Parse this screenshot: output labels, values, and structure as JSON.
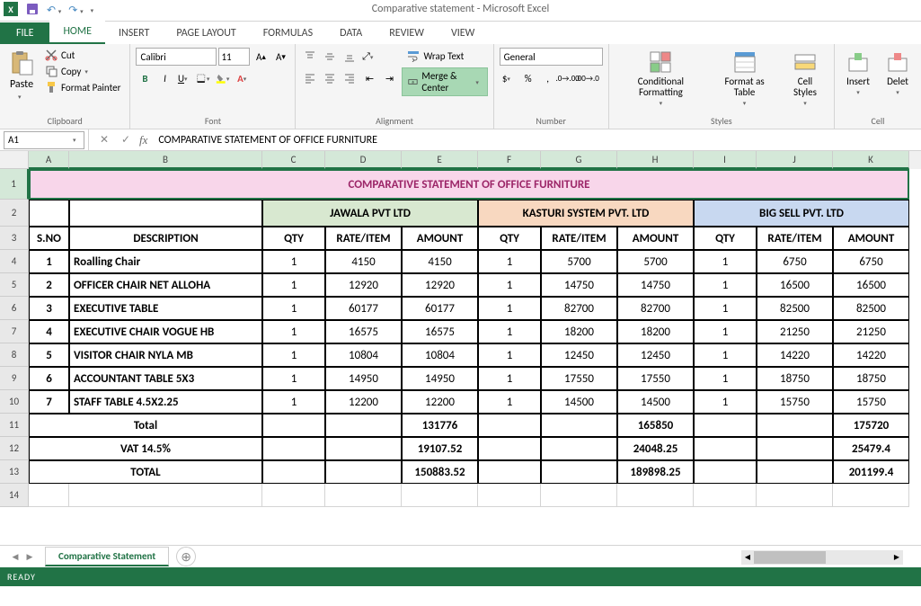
{
  "app": {
    "title": "Comparative statement - Microsoft Excel"
  },
  "tabs": {
    "file": "FILE",
    "home": "HOME",
    "insert": "INSERT",
    "page": "PAGE LAYOUT",
    "formulas": "FORMULAS",
    "data": "DATA",
    "review": "REVIEW",
    "view": "VIEW"
  },
  "clipboard": {
    "paste": "Paste",
    "cut": "Cut",
    "copy": "Copy",
    "painter": "Format Painter",
    "label": "Clipboard"
  },
  "font": {
    "name": "Calibri",
    "size": "11",
    "label": "Font"
  },
  "alignment": {
    "wrap": "Wrap Text",
    "merge": "Merge & Center",
    "label": "Alignment"
  },
  "number": {
    "format": "General",
    "label": "Number"
  },
  "styles": {
    "cond": "Conditional Formatting",
    "table": "Format as Table",
    "cell": "Cell Styles",
    "label": "Styles"
  },
  "cells": {
    "insert": "Insert",
    "delete": "Delet",
    "label": "Cell"
  },
  "namebox": "A1",
  "formula": "COMPARATIVE STATEMENT OF OFFICE FURNITURE",
  "cols": [
    "A",
    "B",
    "C",
    "D",
    "E",
    "F",
    "G",
    "H",
    "I",
    "J",
    "K"
  ],
  "rowH": [
    "1",
    "2",
    "3",
    "4",
    "5",
    "6",
    "7",
    "8",
    "9",
    "10",
    "11",
    "12",
    "13",
    "14"
  ],
  "sheet": {
    "title": "COMPARATIVE STATEMENT OF OFFICE FURNITURE",
    "vendors": [
      "JAWALA PVT LTD",
      "KASTURI SYSTEM PVT. LTD",
      "BIG SELL PVT. LTD"
    ],
    "headers": {
      "sno": "S.NO",
      "desc": "DESCRIPTION",
      "qty": "QTY",
      "rate": "RATE/ITEM",
      "amt": "AMOUNT"
    },
    "rows": [
      {
        "n": "1",
        "d": "Roalling Chair",
        "q1": "1",
        "r1": "4150",
        "a1": "4150",
        "q2": "1",
        "r2": "5700",
        "a2": "5700",
        "q3": "1",
        "r3": "6750",
        "a3": "6750"
      },
      {
        "n": "2",
        "d": "OFFICER CHAIR NET ALLOHA",
        "q1": "1",
        "r1": "12920",
        "a1": "12920",
        "q2": "1",
        "r2": "14750",
        "a2": "14750",
        "q3": "1",
        "r3": "16500",
        "a3": "16500"
      },
      {
        "n": "3",
        "d": "EXECUTIVE TABLE",
        "q1": "1",
        "r1": "60177",
        "a1": "60177",
        "q2": "1",
        "r2": "82700",
        "a2": "82700",
        "q3": "1",
        "r3": "82500",
        "a3": "82500"
      },
      {
        "n": "4",
        "d": "EXECUTIVE CHAIR VOGUE HB",
        "q1": "1",
        "r1": "16575",
        "a1": "16575",
        "q2": "1",
        "r2": "18200",
        "a2": "18200",
        "q3": "1",
        "r3": "21250",
        "a3": "21250"
      },
      {
        "n": "5",
        "d": "VISITOR CHAIR NYLA MB",
        "q1": "1",
        "r1": "10804",
        "a1": "10804",
        "q2": "1",
        "r2": "12450",
        "a2": "12450",
        "q3": "1",
        "r3": "14220",
        "a3": "14220"
      },
      {
        "n": "6",
        "d": "ACCOUNTANT TABLE 5X3",
        "q1": "1",
        "r1": "14950",
        "a1": "14950",
        "q2": "1",
        "r2": "17550",
        "a2": "17550",
        "q3": "1",
        "r3": "18750",
        "a3": "18750"
      },
      {
        "n": "7",
        "d": "STAFF TABLE 4.5X2.25",
        "q1": "1",
        "r1": "12200",
        "a1": "12200",
        "q2": "1",
        "r2": "14500",
        "a2": "14500",
        "q3": "1",
        "r3": "15750",
        "a3": "15750"
      }
    ],
    "totals": {
      "label": "Total",
      "a1": "131776",
      "a2": "165850",
      "a3": "175720"
    },
    "vat": {
      "label": "VAT 14.5%",
      "a1": "19107.52",
      "a2": "24048.25",
      "a3": "25479.4"
    },
    "grand": {
      "label": "TOTAL",
      "a1": "150883.52",
      "a2": "189898.25",
      "a3": "201199.4"
    }
  },
  "sheetTab": "Comparative Statement",
  "status": "READY"
}
